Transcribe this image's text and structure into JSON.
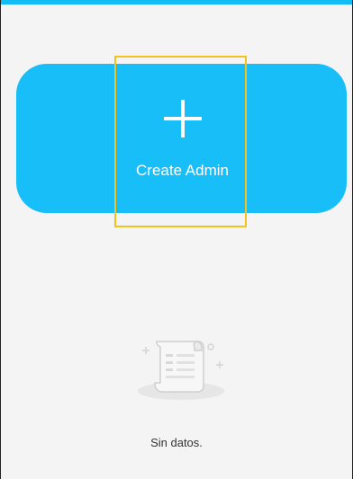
{
  "colors": {
    "accent": "#18bef8",
    "top_bar": "#12bcf5",
    "highlight": "#f3c21c",
    "background": "#f4f4f4"
  },
  "create_card": {
    "icon": "plus-icon",
    "label": "Create Admin"
  },
  "empty_state": {
    "icon": "document-scroll-icon",
    "text": "Sin datos."
  }
}
